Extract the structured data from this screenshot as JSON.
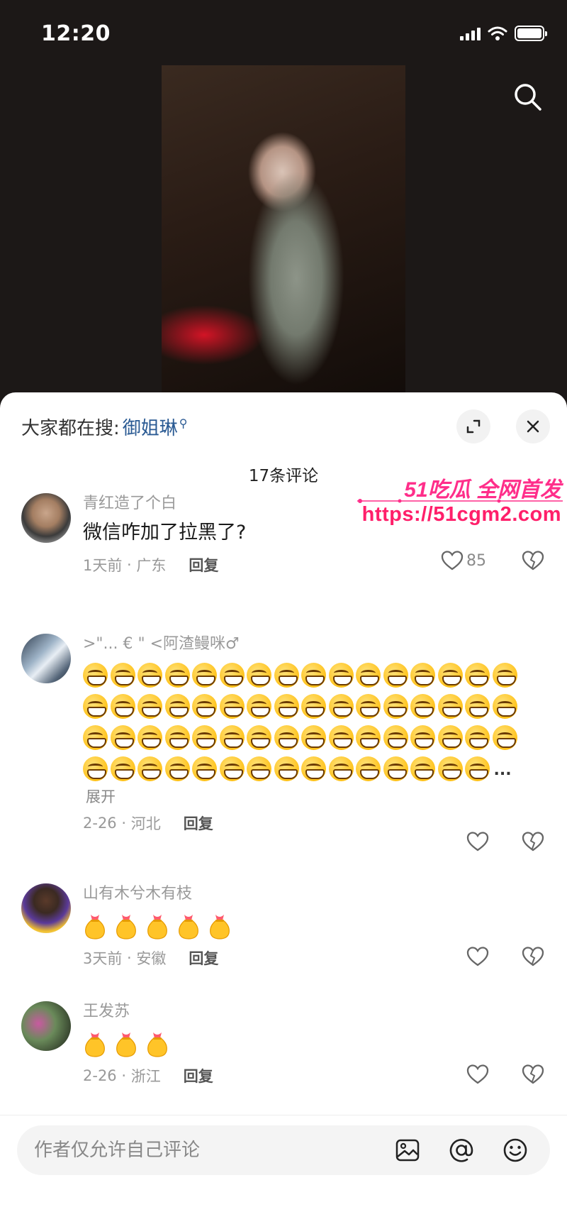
{
  "status": {
    "time": "12:20"
  },
  "sheet": {
    "hot_search_label": "大家都在搜:",
    "hot_search_term": "御姐琳",
    "comment_count": "17条评论"
  },
  "watermark": {
    "title": "51吃瓜 全网首发",
    "url": "https://51cgm2.com"
  },
  "comments": [
    {
      "user": "青红造了个白",
      "text": "微信咋加了拉黑了?",
      "time": "1天前",
      "location": "广东",
      "reply": "回复",
      "likes": "85"
    },
    {
      "user": ">\"...   € \" <阿渣鳗咪♂",
      "emoji_count": 63,
      "expand": "展开",
      "ellipsis": "...",
      "time": "2-26",
      "location": "河北",
      "reply": "回复"
    },
    {
      "user": "山有木兮木有枝",
      "bag_count": 5,
      "time": "3天前",
      "location": "安徽",
      "reply": "回复"
    },
    {
      "user": "王发苏",
      "bag_count": 3,
      "time": "2-26",
      "location": "浙江",
      "reply": "回复"
    }
  ],
  "input": {
    "placeholder": "作者仅允许自己评论"
  },
  "colors": {
    "accent_link": "#2a5a93",
    "watermark": "#ff1f6a"
  }
}
